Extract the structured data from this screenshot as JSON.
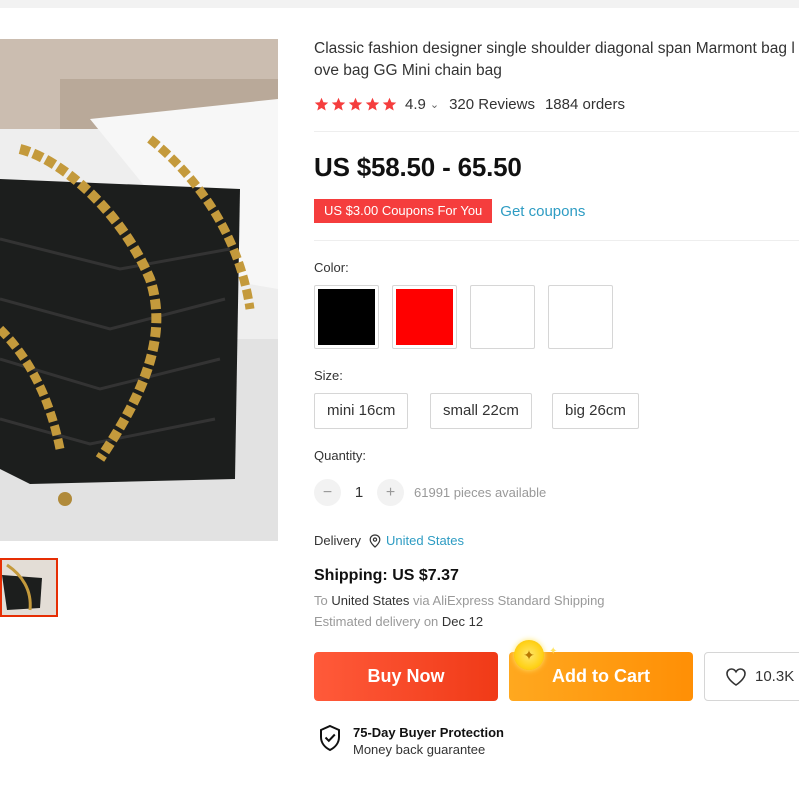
{
  "product": {
    "title": "Classic fashion designer single shoulder diagonal span Marmont bag love bag GG Mini chain bag",
    "rating": "4.9",
    "rating_chevron": "⌄",
    "reviews": "320 Reviews",
    "orders": "1884 orders",
    "price": "US $58.50 - 65.50",
    "coupon_tag": "US $3.00 Coupons For You",
    "coupon_link": "Get coupons"
  },
  "options": {
    "color_label": "Color:",
    "colors": [
      "#000000",
      "#ff0000",
      "#ffffff",
      "#ffffff"
    ],
    "size_label": "Size:",
    "sizes": [
      "mini 16cm",
      "small 22cm",
      "big 26cm"
    ],
    "quantity_label": "Quantity:",
    "quantity_minus": "−",
    "quantity_value": "1",
    "quantity_plus": "+",
    "quantity_available": "61991 pieces available"
  },
  "delivery": {
    "label": "Delivery",
    "country": "United States",
    "shipping": "Shipping: US $7.37",
    "to_prefix": "To",
    "to_country": "United States",
    "via_text": "via AliExpress Standard Shipping",
    "estimated_prefix": "Estimated delivery on",
    "estimated_date": "Dec 12"
  },
  "actions": {
    "buy_now": "Buy Now",
    "add_to_cart": "Add to Cart",
    "wishlist_count": "10.3K"
  },
  "protection": {
    "title": "75-Day Buyer Protection",
    "subtitle": "Money back guarantee"
  },
  "icons": {
    "star": "star-icon",
    "location": "location-pin-icon",
    "heart": "heart-icon",
    "shield": "shield-check-icon",
    "coin": "coin-icon"
  },
  "colors": {
    "accent_red": "#f53d3d",
    "link_blue": "#2e9cc3",
    "buy_now": "#f03a17",
    "add_to_cart": "#ff8f05"
  }
}
